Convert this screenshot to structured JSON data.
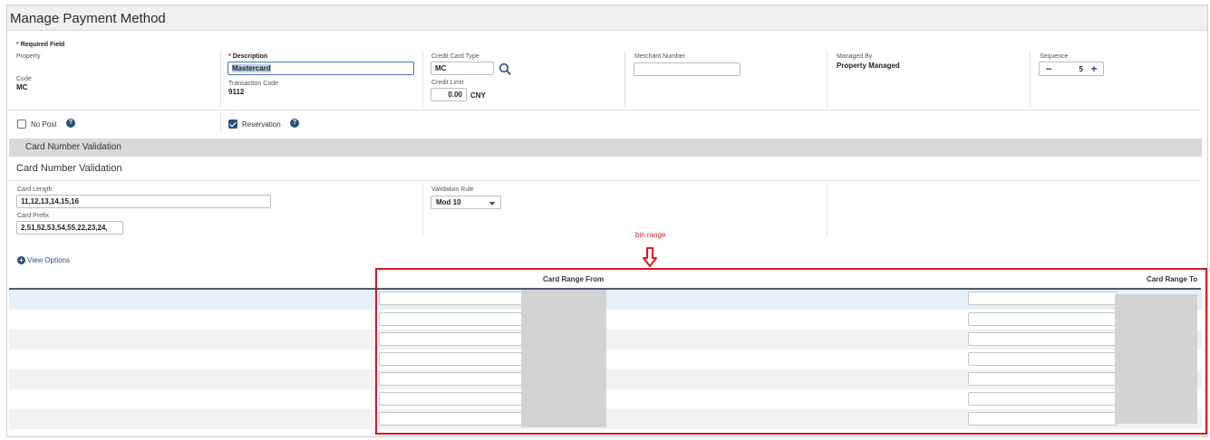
{
  "window": {
    "title": "Manage Payment Method"
  },
  "form": {
    "required_note": "* Required Field",
    "property_label": "Property",
    "code_label": "Code",
    "code_value": "MC",
    "description_label": "Description",
    "description_value": "Mastercard",
    "transaction_code_label": "Transaction Code",
    "transaction_code_value": "9112",
    "credit_card_type_label": "Credit Card Type",
    "credit_card_type_value": "MC",
    "credit_limit_label": "Credit Limit",
    "credit_limit_value": "0.00",
    "currency": "CNY",
    "merchant_number_label": "Merchant Number",
    "merchant_number_value": "",
    "managed_by_label": "Managed By",
    "managed_by_value": "Property Managed",
    "sequence_label": "Sequence",
    "sequence_value": "5",
    "sequence_minus": "−",
    "sequence_plus": "+",
    "no_post_label": "No Post",
    "no_post_checked": false,
    "reservation_label": "Reservation",
    "reservation_checked": true,
    "help_glyph": "?"
  },
  "validation": {
    "section_band_title": "Card Number Validation",
    "subtitle": "Card Number Validation",
    "card_length_label": "Card Length",
    "card_length_value": "11,12,13,14,15,16",
    "card_prefix_label": "Card Prefix",
    "card_prefix_value": "2,51,52,53,54,55,22,23,24,",
    "validation_rule_label": "Validation Rule",
    "validation_rule_value": "Mod 10"
  },
  "view_options": {
    "label": "View Options",
    "icon": "plus-circle-icon"
  },
  "annotation": {
    "text": "bin range",
    "color": "#d4202a"
  },
  "table": {
    "columns": [
      "Card Range From",
      "Card Range To"
    ],
    "row_count": 7
  },
  "colors": {
    "accent": "#2a4f7c",
    "highlight": "#e0141b",
    "band": "#d9d9d9"
  }
}
